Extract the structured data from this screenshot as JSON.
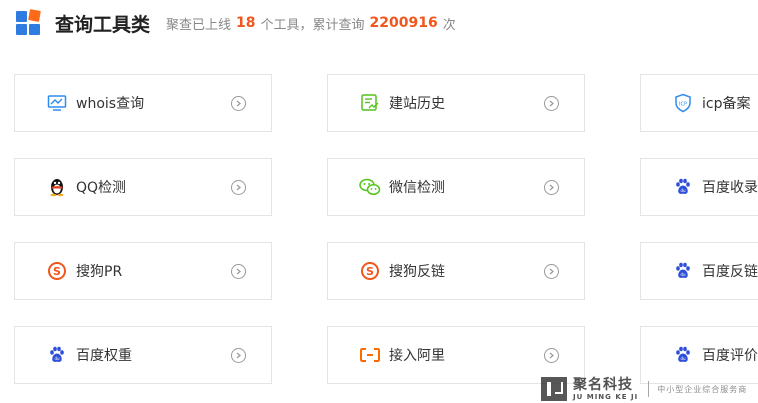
{
  "header": {
    "title": "查询工具类",
    "summary_prefix": "聚查已上线",
    "tool_count": "18",
    "summary_middle": "个工具，累计查询",
    "query_count": "2200916",
    "summary_suffix": "次"
  },
  "tools": [
    {
      "label": "whois查询",
      "icon": "monitor-chart-icon",
      "color": "#2f8cf0"
    },
    {
      "label": "建站历史",
      "icon": "site-history-icon",
      "color": "#52c41a"
    },
    {
      "label": "icp备案",
      "icon": "icp-shield-icon",
      "color": "#2f8cf0"
    },
    {
      "label": "QQ检测",
      "icon": "qq-penguin-icon",
      "color": "#000000"
    },
    {
      "label": "微信检测",
      "icon": "wechat-icon",
      "color": "#52c41a"
    },
    {
      "label": "百度收录",
      "icon": "baidu-paw-icon",
      "color": "#2f4fd8"
    },
    {
      "label": "搜狗PR",
      "icon": "sogou-icon",
      "color": "#f0571c"
    },
    {
      "label": "搜狗反链",
      "icon": "sogou-icon",
      "color": "#f0571c"
    },
    {
      "label": "百度反链",
      "icon": "baidu-paw-icon",
      "color": "#2f4fd8"
    },
    {
      "label": "百度权重",
      "icon": "baidu-paw-icon",
      "color": "#2f4fd8"
    },
    {
      "label": "接入阿里",
      "icon": "aliyun-icon",
      "color": "#ff6a00"
    },
    {
      "label": "百度评价",
      "icon": "baidu-paw-icon",
      "color": "#2f4fd8"
    }
  ],
  "watermark": {
    "name_cn": "聚名科技",
    "name_en": "JU MING KE JI",
    "slogan": "中小型企业综合服务商"
  }
}
